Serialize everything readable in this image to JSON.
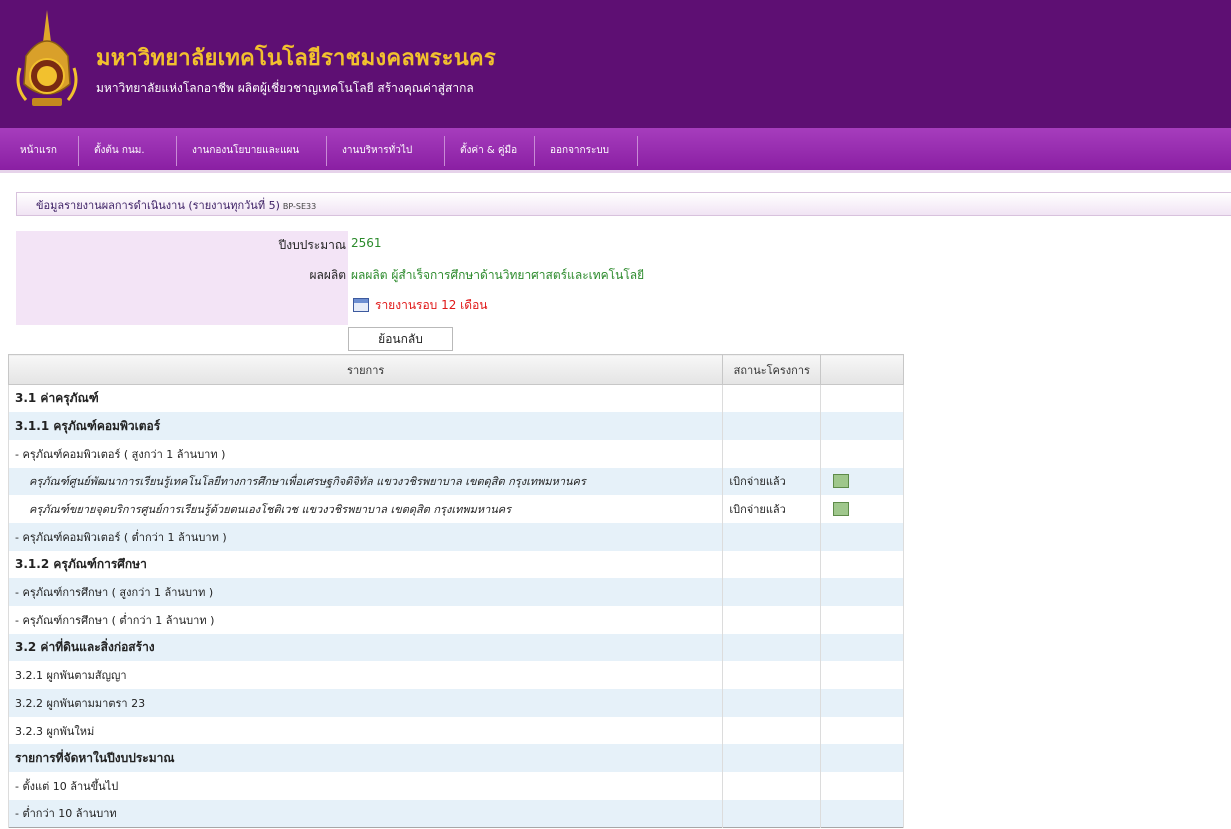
{
  "header": {
    "title": "มหาวิทยาลัยเทคโนโลยีราชมงคลพระนคร",
    "subtitle": "มหาวิทยาลัยแห่งโลกอาชีพ ผลิตผู้เชี่ยวชาญเทคโนโลยี สร้างคุณค่าสู่สากล"
  },
  "nav": {
    "items": [
      {
        "label": "หน้าแรก"
      },
      {
        "label": "ตั้งต้น กนม."
      },
      {
        "label": "งานกองนโยบายและแผน"
      },
      {
        "label": "งานบริหารทั่วไป"
      },
      {
        "label": "ตั้งค่า & คู่มือ"
      },
      {
        "label": "ออกจากระบบ"
      }
    ]
  },
  "section": {
    "title": "ข้อมูลรายงานผลการดำเนินงาน (รายงานทุกวันที่ 5)",
    "code": "BP-SE33"
  },
  "info": {
    "year_label": "ปีงบประมาณ",
    "year_value": "2561",
    "output_label": "ผลผลิต",
    "output_value": "ผลผลิต ผู้สำเร็จการศึกษาด้านวิทยาศาสตร์และเทคโนโลยี",
    "report_link": "รายงานรอบ 12 เดือน",
    "back_button": "ย้อนกลับ"
  },
  "table": {
    "headers": [
      "รายการ",
      "สถานะโครงการ",
      ""
    ],
    "rows": [
      {
        "label": "3.1 ค่าครุภัณฑ์",
        "status": ""
      },
      {
        "label": "3.1.1 ครุภัณฑ์คอมพิวเตอร์",
        "status": ""
      },
      {
        "label": "- ครุภัณฑ์คอมพิวเตอร์ ( สูงกว่า 1 ล้านบาท )",
        "status": ""
      },
      {
        "label": "ครุภัณฑ์ศูนย์พัฒนาการเรียนรู้เทคโนโลยีทางการศึกษาเพื่อเศรษฐกิจดิจิทัล แขวงวชิรพยาบาล เขตดุสิต กรุงเทพมหานคร",
        "status": "เบิกจ่ายแล้ว"
      },
      {
        "label": "ครุภัณฑ์ขยายจุดบริการศูนย์การเรียนรู้ด้วยตนเองโชติเวช แขวงวชิรพยาบาล เขตดุสิต กรุงเทพมหานคร",
        "status": "เบิกจ่ายแล้ว"
      },
      {
        "label": "- ครุภัณฑ์คอมพิวเตอร์ ( ต่ำกว่า 1 ล้านบาท )",
        "status": ""
      },
      {
        "label": "3.1.2 ครุภัณฑ์การศึกษา",
        "status": ""
      },
      {
        "label": "- ครุภัณฑ์การศึกษา ( สูงกว่า 1 ล้านบาท )",
        "status": ""
      },
      {
        "label": "- ครุภัณฑ์การศึกษา ( ต่ำกว่า 1 ล้านบาท )",
        "status": ""
      },
      {
        "label": "3.2 ค่าที่ดินและสิ่งก่อสร้าง",
        "status": ""
      },
      {
        "label": "3.2.1 ผูกพันตามสัญญา",
        "status": ""
      },
      {
        "label": "3.2.2 ผูกพันตามมาตรา 23",
        "status": ""
      },
      {
        "label": "3.2.3 ผูกพันใหม่",
        "status": ""
      },
      {
        "label": "รายการที่จัดหาในปีงบประมาณ",
        "status": ""
      },
      {
        "label": "- ตั้งแต่ 10 ล้านขึ้นไป",
        "status": ""
      },
      {
        "label": "- ต่ำกว่า 10 ล้านบาท",
        "status": ""
      }
    ]
  }
}
